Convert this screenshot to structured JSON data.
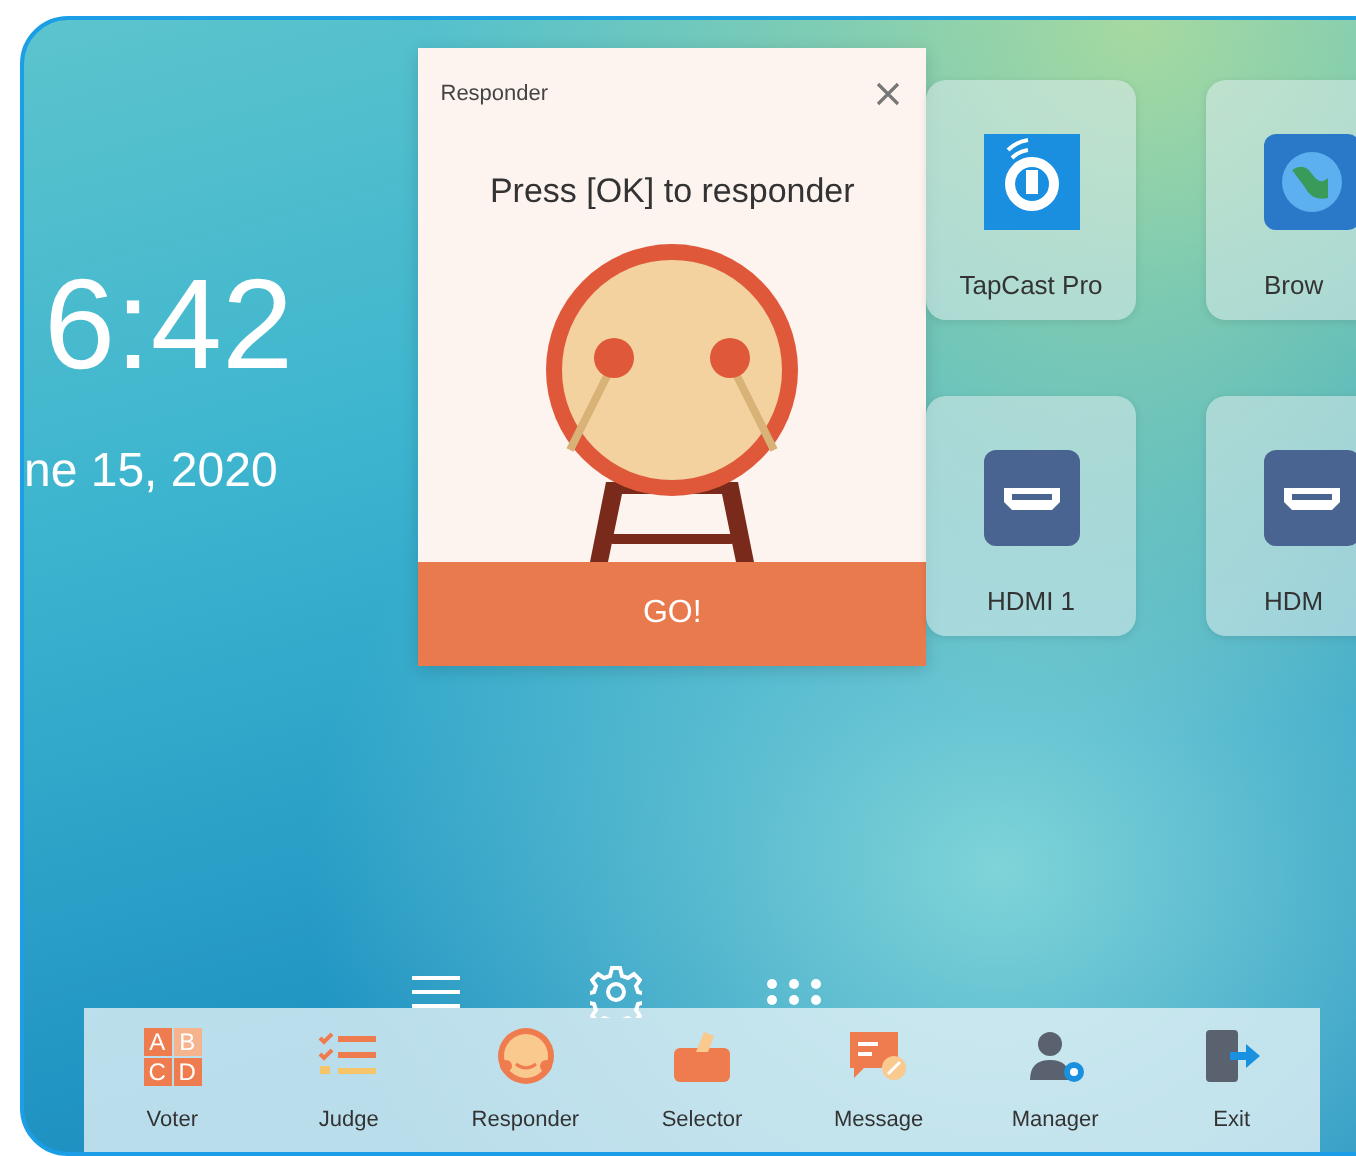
{
  "clock": {
    "time": "6:42",
    "date": "ne 15, 2020"
  },
  "dialog": {
    "title": "Responder",
    "message": "Press [OK] to responder",
    "button": "GO!"
  },
  "apps": [
    {
      "label": "TapCast Pro",
      "kind": "tapcast"
    },
    {
      "label": "Brow",
      "kind": "browser"
    },
    {
      "label": "HDMI 1",
      "kind": "hdmi"
    },
    {
      "label": "HDM",
      "kind": "hdmi"
    }
  ],
  "toolbar": [
    {
      "label": "Voter",
      "kind": "voter",
      "letters": [
        "A",
        "B",
        "C",
        "D"
      ]
    },
    {
      "label": "Judge",
      "kind": "judge"
    },
    {
      "label": "Responder",
      "kind": "responder"
    },
    {
      "label": "Selector",
      "kind": "selector"
    },
    {
      "label": "Message",
      "kind": "message"
    },
    {
      "label": "Manager",
      "kind": "manager"
    },
    {
      "label": "Exit",
      "kind": "exit"
    }
  ]
}
